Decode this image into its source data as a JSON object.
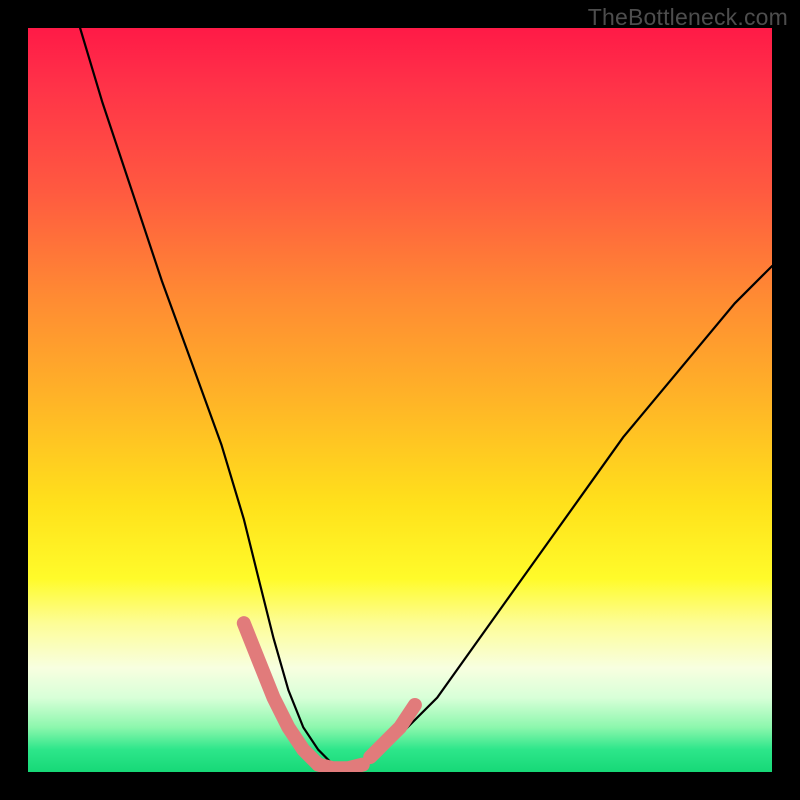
{
  "watermark": "TheBottleneck.com",
  "chart_data": {
    "type": "line",
    "title": "",
    "xlabel": "",
    "ylabel": "",
    "xlim": [
      0,
      100
    ],
    "ylim": [
      0,
      100
    ],
    "grid": false,
    "gradient_colors": [
      "#ff1a47",
      "#ff5a40",
      "#ffb427",
      "#fffb2a",
      "#f8ffe0",
      "#2de68a",
      "#17d877"
    ],
    "series": [
      {
        "name": "bottleneck-curve",
        "stroke": "#000000",
        "x": [
          7,
          10,
          14,
          18,
          22,
          26,
          29,
          31,
          33,
          35,
          37,
          39,
          41,
          43,
          46,
          50,
          55,
          60,
          65,
          70,
          75,
          80,
          85,
          90,
          95,
          100
        ],
        "y": [
          100,
          90,
          78,
          66,
          55,
          44,
          34,
          26,
          18,
          11,
          6,
          3,
          1,
          1,
          2,
          5,
          10,
          17,
          24,
          31,
          38,
          45,
          51,
          57,
          63,
          68
        ]
      },
      {
        "name": "highlight-left",
        "stroke": "#e17b7b",
        "x": [
          29,
          31,
          33,
          35,
          37,
          39
        ],
        "y": [
          20,
          15,
          10,
          6,
          3,
          1
        ]
      },
      {
        "name": "highlight-bottom",
        "stroke": "#e17b7b",
        "x": [
          39,
          41,
          43,
          45
        ],
        "y": [
          1,
          0.5,
          0.5,
          1
        ]
      },
      {
        "name": "highlight-right",
        "stroke": "#e17b7b",
        "x": [
          46,
          48,
          50,
          52
        ],
        "y": [
          2,
          4,
          6,
          9
        ]
      }
    ]
  }
}
